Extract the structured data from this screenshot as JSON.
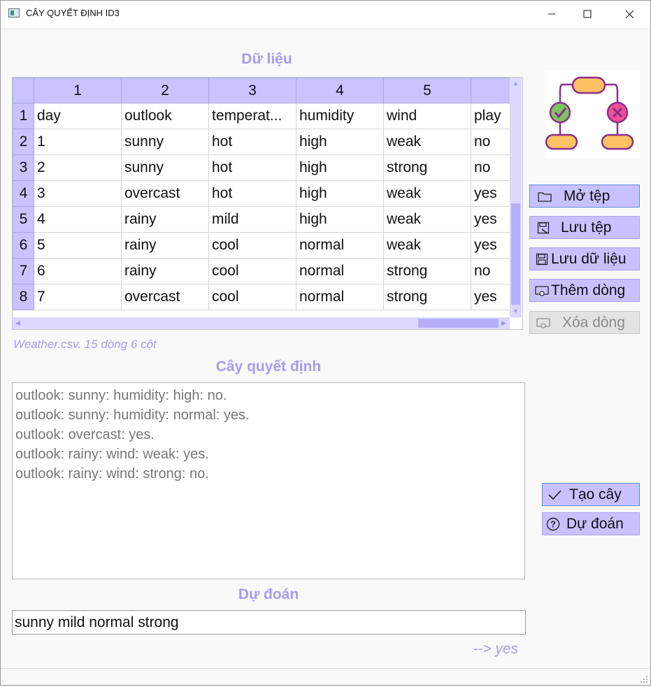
{
  "window": {
    "title": "CÂY QUYẾT ĐỊNH ID3"
  },
  "data_section": {
    "title": "Dữ liệu"
  },
  "grid": {
    "column_headers": [
      "1",
      "2",
      "3",
      "4",
      "5",
      ""
    ],
    "rows": [
      {
        "header": "1",
        "cells": [
          "day",
          "outlook",
          "temperat...",
          "humidity",
          "wind",
          "play"
        ]
      },
      {
        "header": "2",
        "cells": [
          "1",
          "sunny",
          "hot",
          "high",
          "weak",
          "no"
        ]
      },
      {
        "header": "3",
        "cells": [
          "2",
          "sunny",
          "hot",
          "high",
          "strong",
          "no"
        ]
      },
      {
        "header": "4",
        "cells": [
          "3",
          "overcast",
          "hot",
          "high",
          "weak",
          "yes"
        ]
      },
      {
        "header": "5",
        "cells": [
          "4",
          "rainy",
          "mild",
          "high",
          "weak",
          "yes"
        ]
      },
      {
        "header": "6",
        "cells": [
          "5",
          "rainy",
          "cool",
          "normal",
          "weak",
          "yes"
        ]
      },
      {
        "header": "7",
        "cells": [
          "6",
          "rainy",
          "cool",
          "normal",
          "strong",
          "no"
        ]
      },
      {
        "header": "8",
        "cells": [
          "7",
          "overcast",
          "cool",
          "normal",
          "strong",
          "yes"
        ]
      }
    ]
  },
  "status": {
    "text": "Weather.csv. 15 dòng 6 cột"
  },
  "tree_section": {
    "title": "Cây quyết định",
    "lines": [
      "outlook: sunny: humidity: high: no.",
      "outlook: sunny: humidity: normal: yes.",
      "outlook: overcast: yes.",
      "outlook: rainy: wind: weak: yes.",
      "outlook: rainy: wind: strong: no."
    ]
  },
  "predict_section": {
    "title": "Dự đoán",
    "input_value": "sunny mild normal strong",
    "result": "--> yes"
  },
  "buttons": {
    "open_file": {
      "label": "Mở tệp",
      "icon": "folder-icon"
    },
    "save_file": {
      "label": "Lưu tệp",
      "icon": "save-as-icon"
    },
    "save_data": {
      "label": "Lưu dữ liệu",
      "icon": "floppy-icon"
    },
    "add_row": {
      "label": "Thêm dòng",
      "icon": "add-row-icon"
    },
    "delete_row": {
      "label": "Xóa dòng",
      "icon": "remove-row-icon",
      "disabled": true
    },
    "build_tree": {
      "label": "Tạo cây",
      "icon": "check-icon"
    },
    "predict": {
      "label": "Dự đoán",
      "icon": "question-circle-icon"
    }
  },
  "colors": {
    "accent": "#a99bf0",
    "header_bg": "#c9c4ff",
    "button_bg": "#c7c2ff",
    "logo_orange": "#fdc263",
    "logo_purple": "#8a2e8c",
    "logo_green": "#7cc55e",
    "logo_pink": "#f0509a"
  }
}
